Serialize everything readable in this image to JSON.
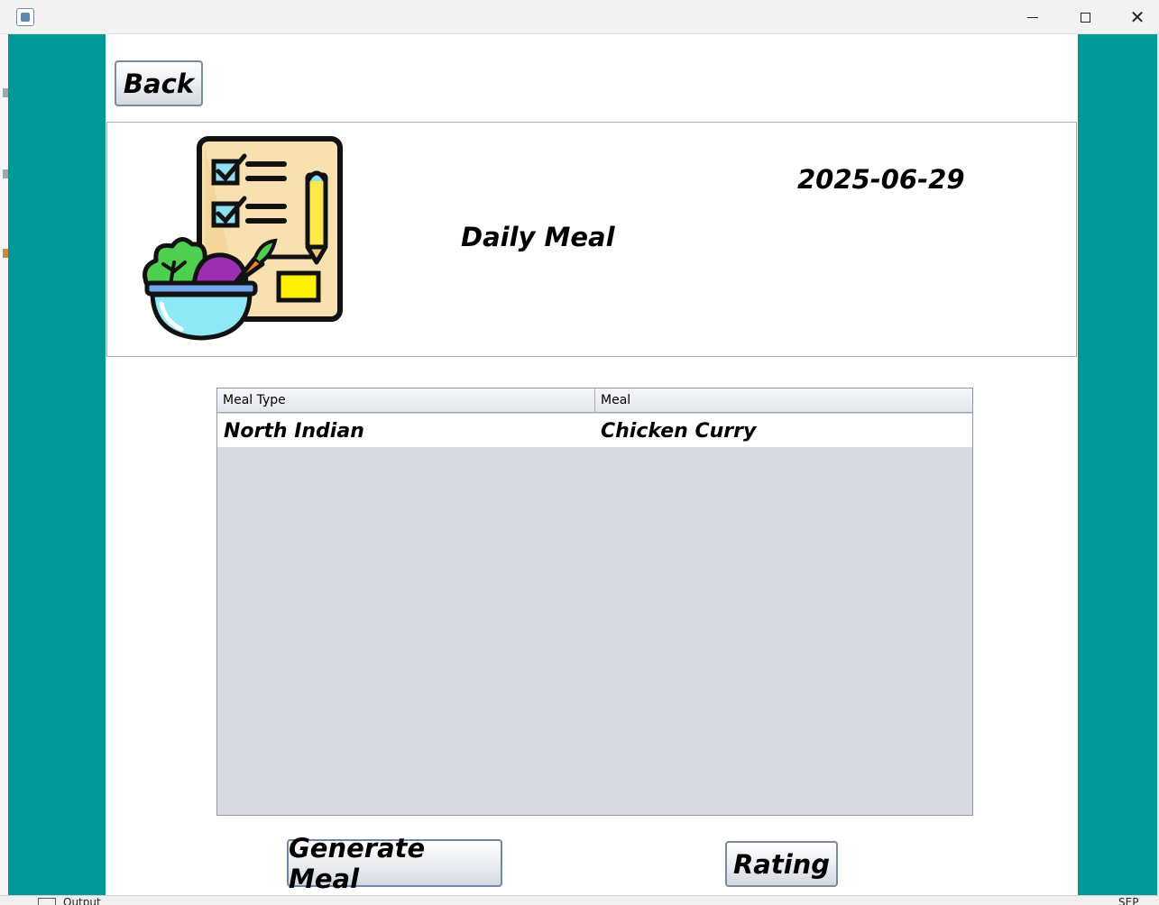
{
  "window": {
    "controls": {
      "minimize": "minimize",
      "maximize": "maximize",
      "close": "✕"
    }
  },
  "toolbar": {
    "back_label": "Back"
  },
  "header": {
    "title": "Daily Meal",
    "date": "2025-06-29",
    "logo_icon": "meal-plan-checklist-icon"
  },
  "table": {
    "columns": [
      "Meal Type",
      "Meal"
    ],
    "rows": [
      [
        "North Indian",
        "Chicken Curry"
      ]
    ]
  },
  "actions": {
    "generate_label": "Generate Meal",
    "rating_label": "Rating"
  },
  "taskbar": {
    "left_text": "Output",
    "right_text": "SEP"
  },
  "colors": {
    "background": "#009999",
    "panel": "#ffffff",
    "table_empty": "#d7dae1"
  }
}
